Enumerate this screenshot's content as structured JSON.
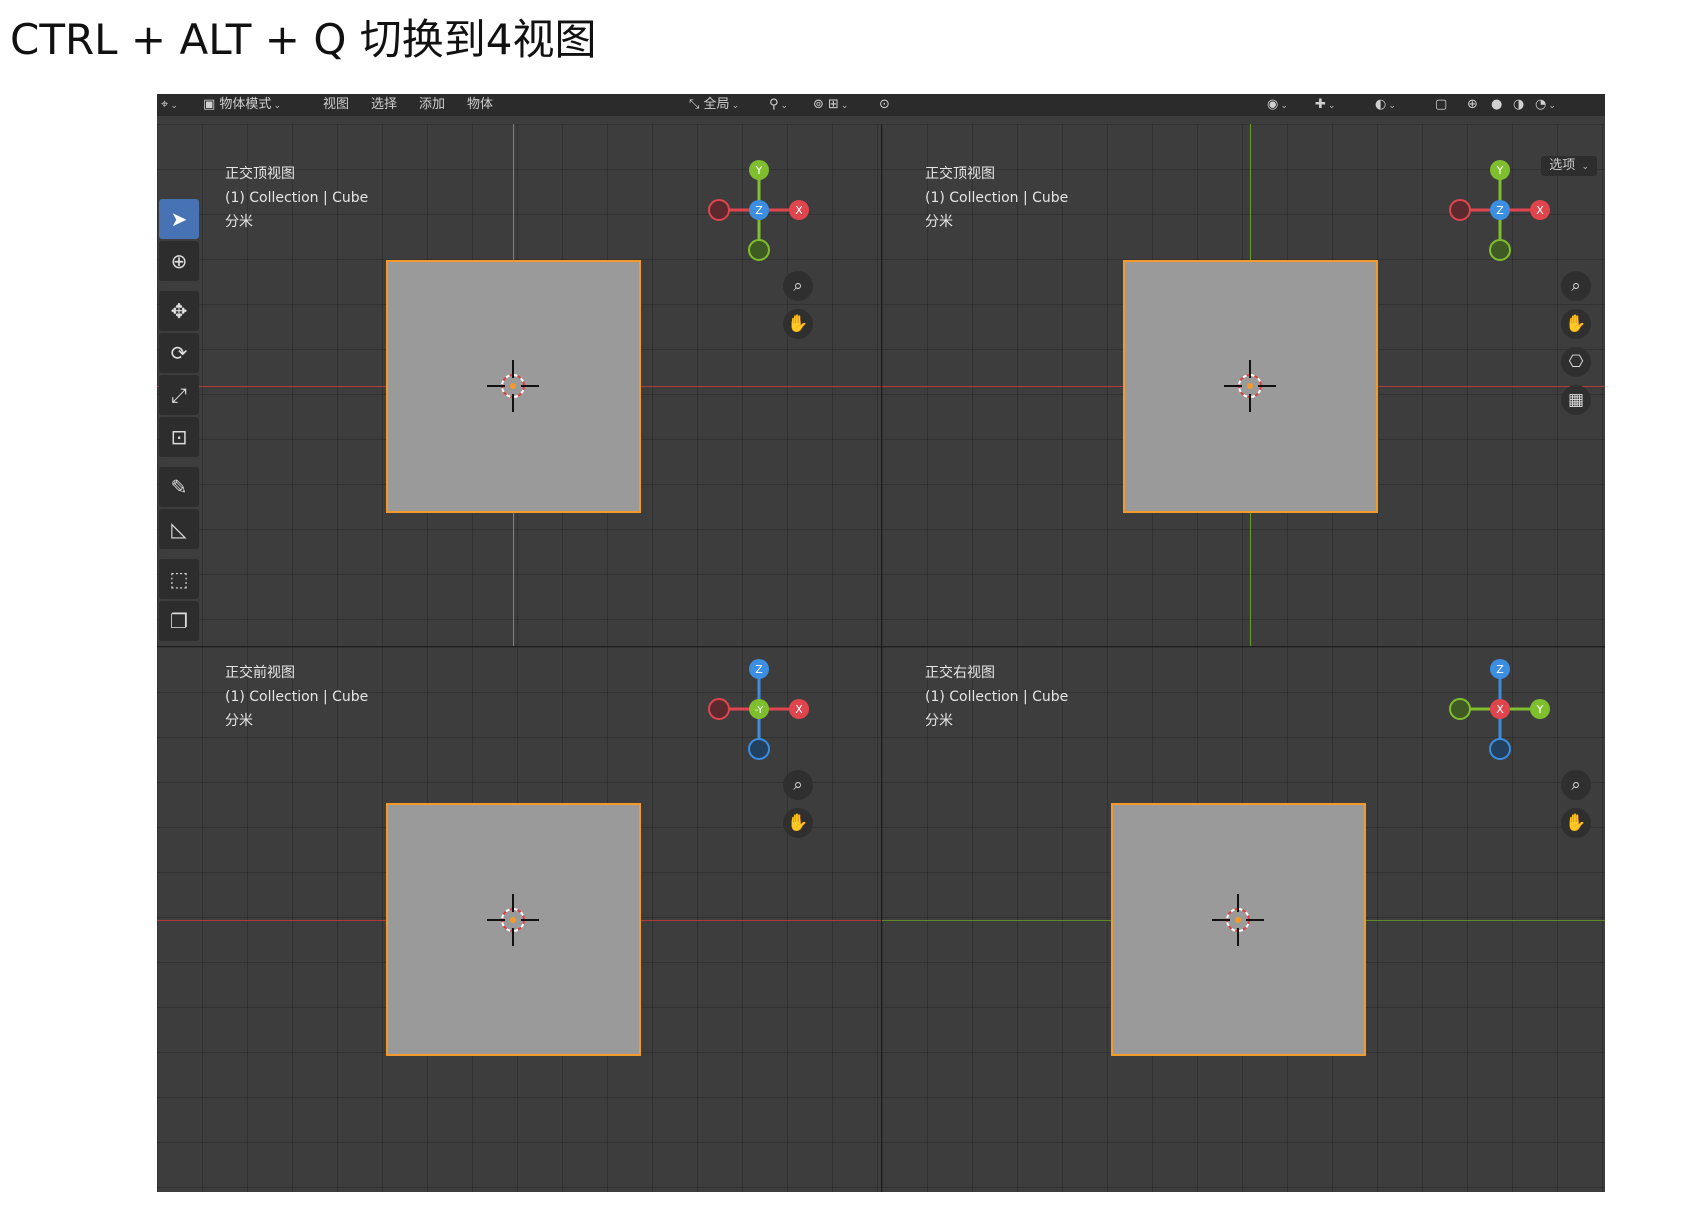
{
  "slide": {
    "title": "CTRL + ALT + Q 切换到4视图"
  },
  "header": {
    "mode": "物体模式",
    "menus": [
      "视图",
      "选择",
      "添加",
      "物体"
    ],
    "transform_orientation": "全局",
    "options": "选项"
  },
  "views": [
    {
      "id": "tl",
      "title": "正交顶视图",
      "collection": "(1) Collection | Cube",
      "units": "分米",
      "gizmo": {
        "top": "Y",
        "center": "Z",
        "right": "X",
        "left": "",
        "bottom": ""
      }
    },
    {
      "id": "tr",
      "title": "正交顶视图",
      "collection": "(1) Collection | Cube",
      "units": "分米",
      "gizmo": {
        "top": "Y",
        "center": "Z",
        "right": "X",
        "left": "",
        "bottom": ""
      }
    },
    {
      "id": "bl",
      "title": "正交前视图",
      "collection": "(1) Collection | Cube",
      "units": "分米",
      "gizmo": {
        "top": "Z",
        "center": "-Y",
        "right": "X",
        "left": "",
        "bottom": ""
      }
    },
    {
      "id": "br",
      "title": "正交右视图",
      "collection": "(1) Collection | Cube",
      "units": "分米",
      "gizmo": {
        "top": "Z",
        "center": "X",
        "right": "Y",
        "left": "",
        "bottom": ""
      }
    }
  ],
  "colors": {
    "x_axis": "#e0454e",
    "y_axis": "#7fbf2e",
    "z_axis": "#3b8ee0",
    "selection": "#f39a2b",
    "active_tool": "#4772b3"
  },
  "icons": {
    "zoom": "zoom-icon",
    "pan": "hand-icon",
    "camera": "camera-icon",
    "grid": "grid-icon"
  }
}
